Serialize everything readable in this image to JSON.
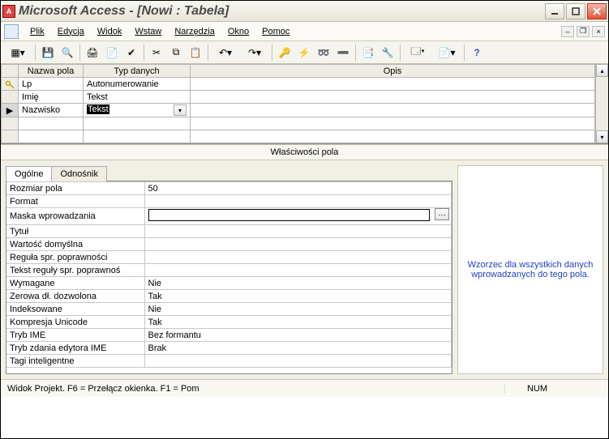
{
  "title": "Microsoft Access - [Nowi : Tabela]",
  "menu": [
    "Plik",
    "Edycja",
    "Widok",
    "Wstaw",
    "Narzędzia",
    "Okno",
    "Pomoc"
  ],
  "grid": {
    "headers": {
      "field": "Nazwa pola",
      "type": "Typ danych",
      "desc": "Opis"
    },
    "rows": [
      {
        "marker": "key",
        "field": "Lp",
        "type": "Autonumerowanie"
      },
      {
        "marker": "",
        "field": "Imię",
        "type": "Tekst"
      },
      {
        "marker": "cur",
        "field": "Nazwisko",
        "type": "Tekst",
        "dd": true
      },
      {
        "marker": "",
        "field": "",
        "type": ""
      },
      {
        "marker": "",
        "field": "",
        "type": ""
      }
    ]
  },
  "section_header": "Właściwości pola",
  "tabs": {
    "general": "Ogólne",
    "lookup": "Odnośnik"
  },
  "props": [
    {
      "name": "Rozmiar pola",
      "value": "50"
    },
    {
      "name": "Format",
      "value": ""
    },
    {
      "name": "Maska wprowadzania",
      "value": "",
      "editing": true
    },
    {
      "name": "Tytuł",
      "value": ""
    },
    {
      "name": "Wartość domyślna",
      "value": ""
    },
    {
      "name": "Reguła spr. poprawności",
      "value": ""
    },
    {
      "name": "Tekst reguły spr. poprawnoś",
      "value": ""
    },
    {
      "name": "Wymagane",
      "value": "Nie"
    },
    {
      "name": "Zerowa dł. dozwolona",
      "value": "Tak"
    },
    {
      "name": "Indeksowane",
      "value": "Nie"
    },
    {
      "name": "Kompresja Unicode",
      "value": "Tak"
    },
    {
      "name": "Tryb IME",
      "value": "Bez formantu"
    },
    {
      "name": "Tryb zdania edytora IME",
      "value": "Brak"
    },
    {
      "name": "Tagi inteligentne",
      "value": ""
    }
  ],
  "help_text": "Wzorzec dla wszystkich danych wprowadzanych do tego pola.",
  "status": {
    "left": "Widok Projekt. F6 = Przełącz okienka. F1 = Pom",
    "num": "NUM"
  }
}
